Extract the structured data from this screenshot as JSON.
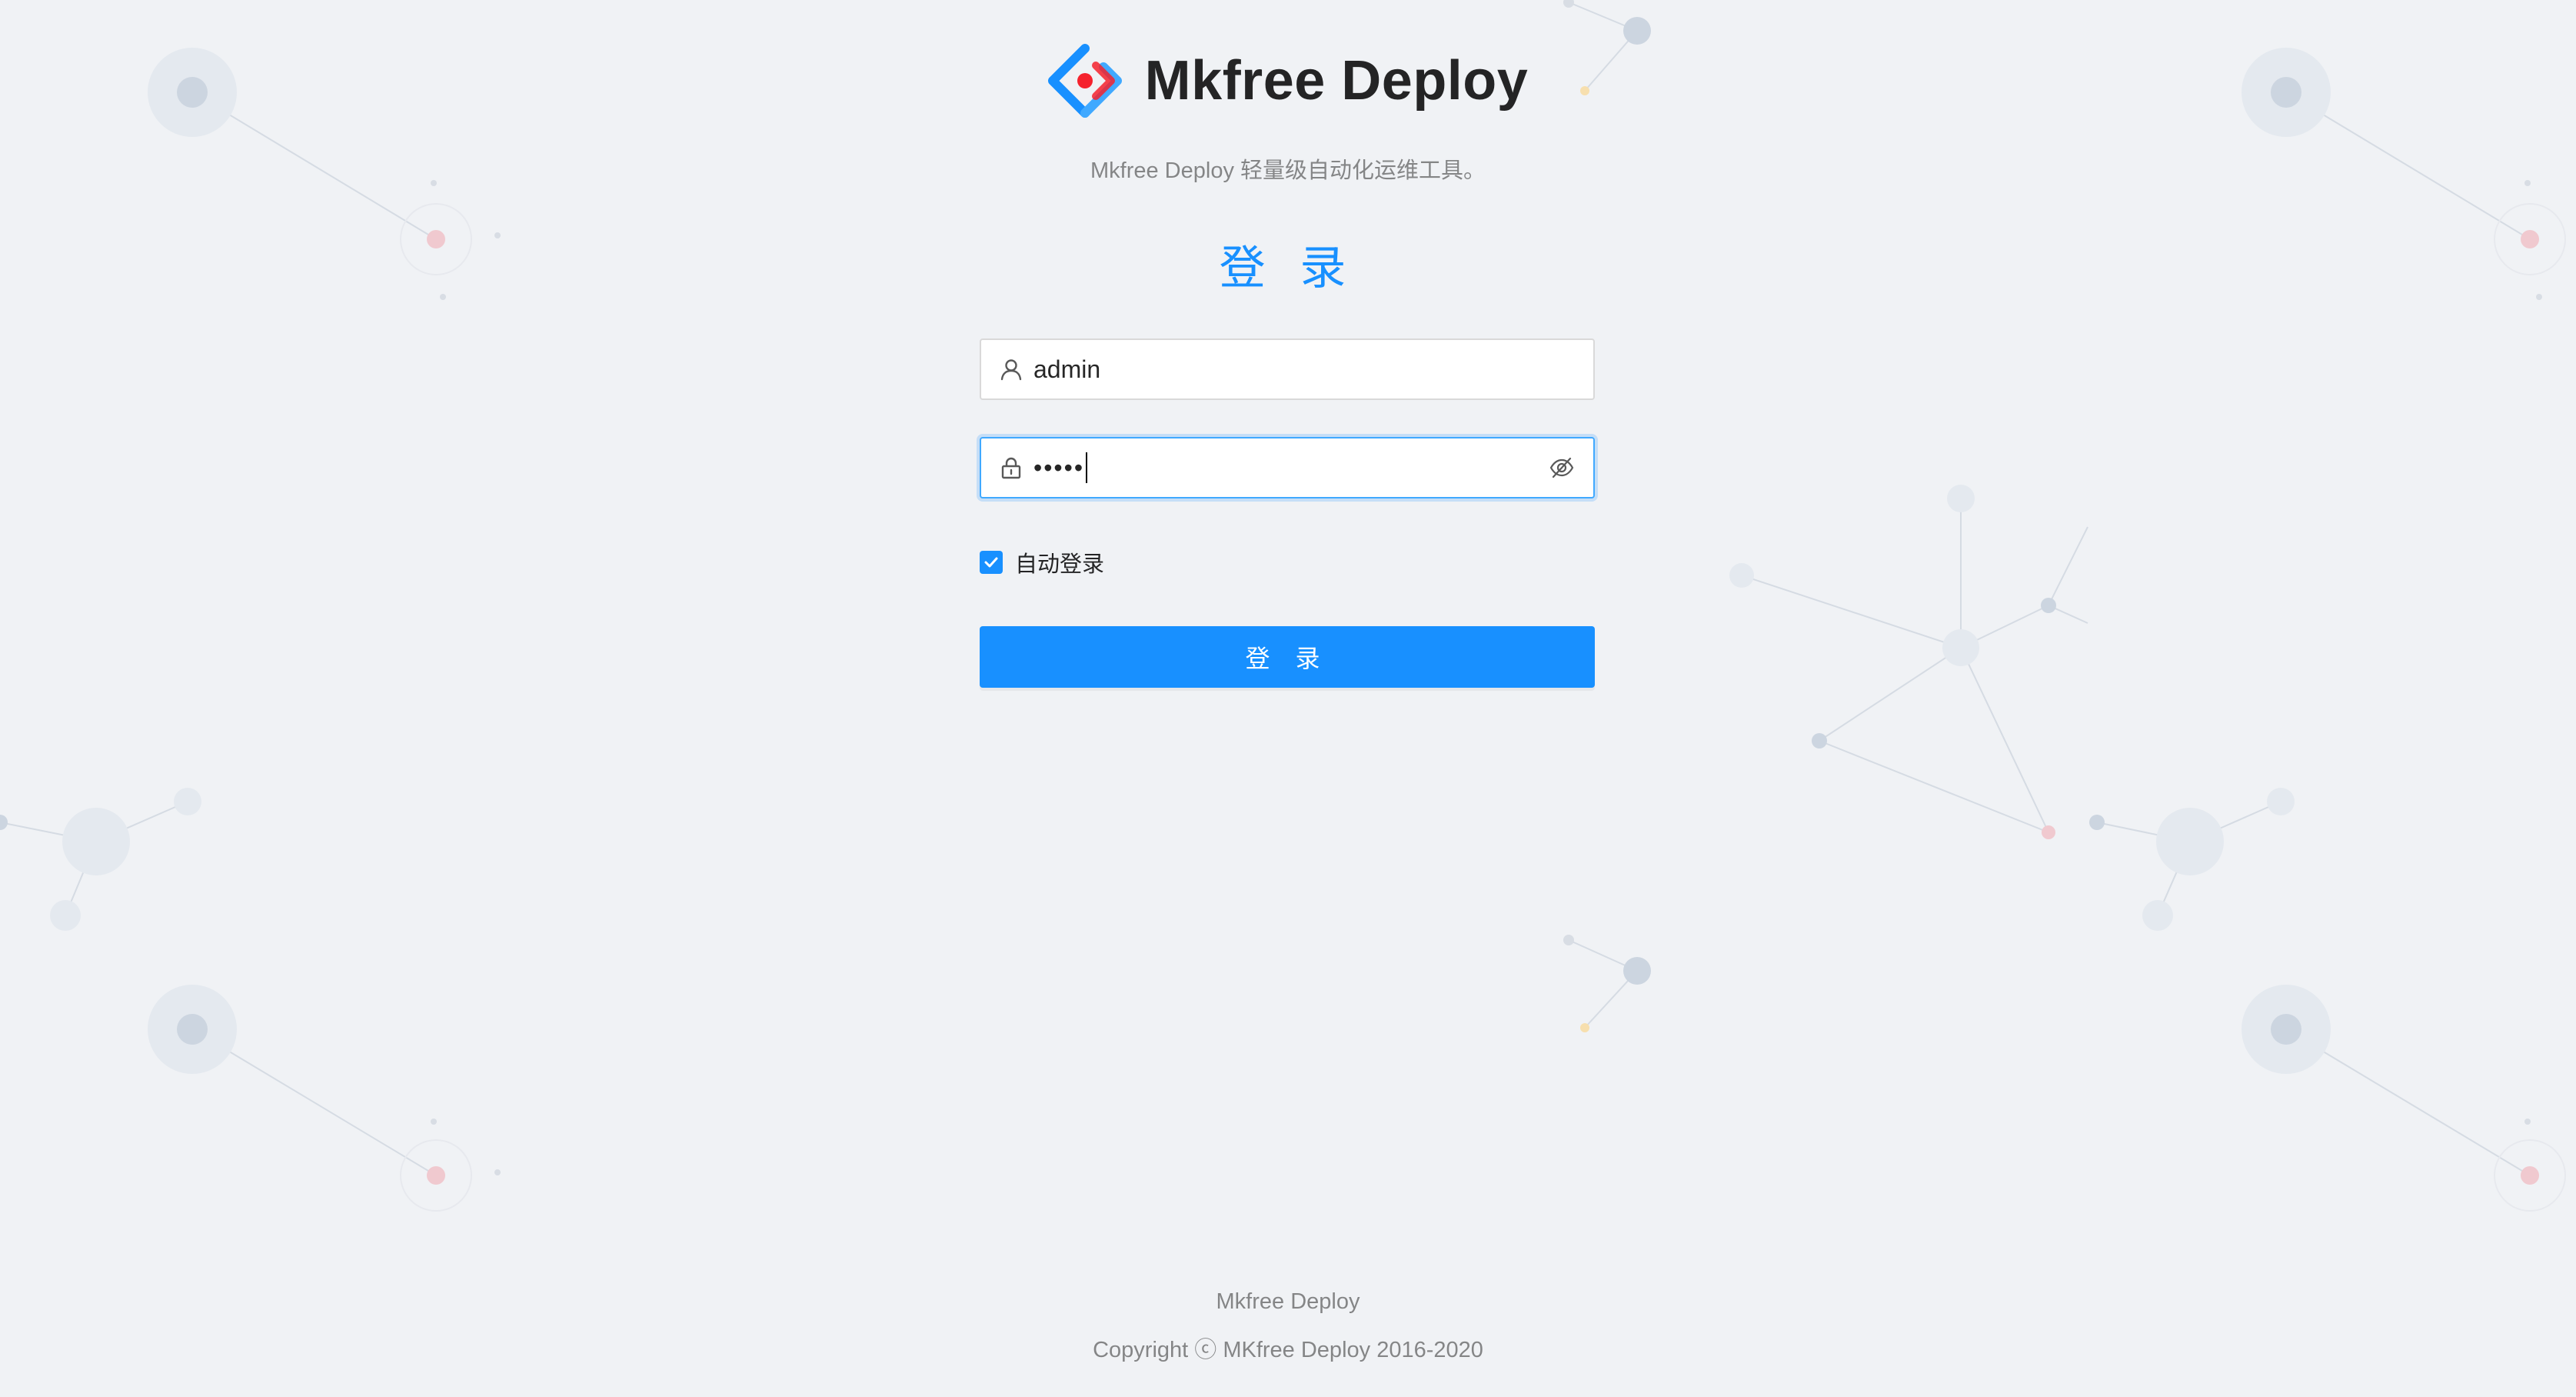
{
  "header": {
    "app_name": "Mkfree Deploy",
    "subtitle": "Mkfree Deploy 轻量级自动化运维工具。"
  },
  "login": {
    "title": "登 录",
    "username_value": "admin",
    "password_masked": "•••••",
    "remember_label": "自动登录",
    "remember_checked": true,
    "submit_label": "登 录"
  },
  "footer": {
    "name": "Mkfree Deploy",
    "copyright": "Copyright ⓒ MKfree Deploy 2016-2020"
  },
  "colors": {
    "primary": "#1890ff",
    "background": "#f0f2f5",
    "logo_blue": "#1890ff",
    "logo_red": "#f5222d"
  },
  "icons": [
    "logo-icon",
    "user-icon",
    "lock-icon",
    "eye-invisible-icon",
    "check-icon"
  ]
}
